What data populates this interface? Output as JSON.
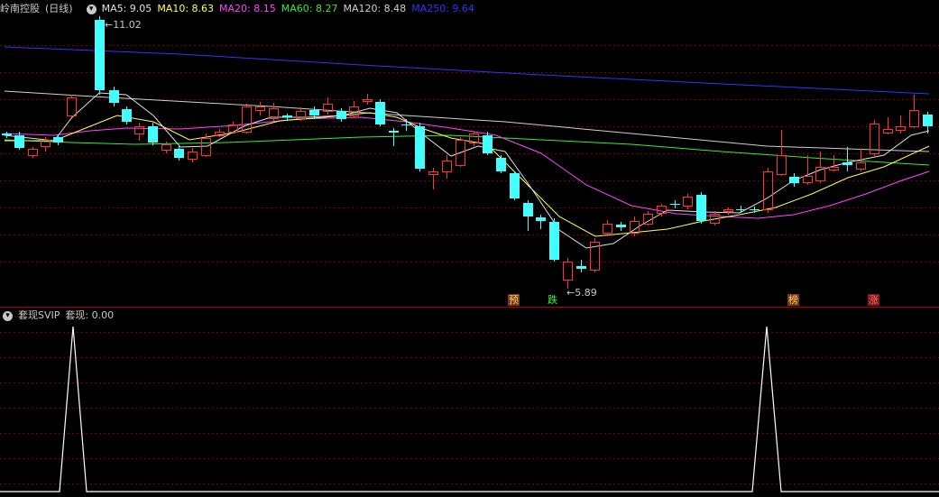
{
  "main_panel": {
    "stock_name": "岭南控股",
    "period": "(日线)",
    "toggle_icon": "chevron-down-icon",
    "indicators": [
      {
        "label": "MA5: 9.05",
        "color": "#e0e0e0"
      },
      {
        "label": "MA10: 8.63",
        "color": "#ffff55"
      },
      {
        "label": "MA20: 8.15",
        "color": "#ff44ff"
      },
      {
        "label": "MA60: 8.27",
        "color": "#33ee33"
      },
      {
        "label": "MA120: 8.48",
        "color": "#d0d0d0"
      },
      {
        "label": "MA250: 9.64",
        "color": "#3333ff"
      }
    ],
    "high_label": "11.02",
    "low_label": "5.89",
    "signals": [
      "预",
      "跌",
      "榜",
      "涨"
    ]
  },
  "sub_panel": {
    "title": "套现SVIP",
    "value_label": "套现: 0.00",
    "toggle_icon": "chevron-down-icon"
  },
  "colors": {
    "up": "#ff3333",
    "down": "#44ffff",
    "grid": "#800000",
    "border": "#b00000"
  }
}
